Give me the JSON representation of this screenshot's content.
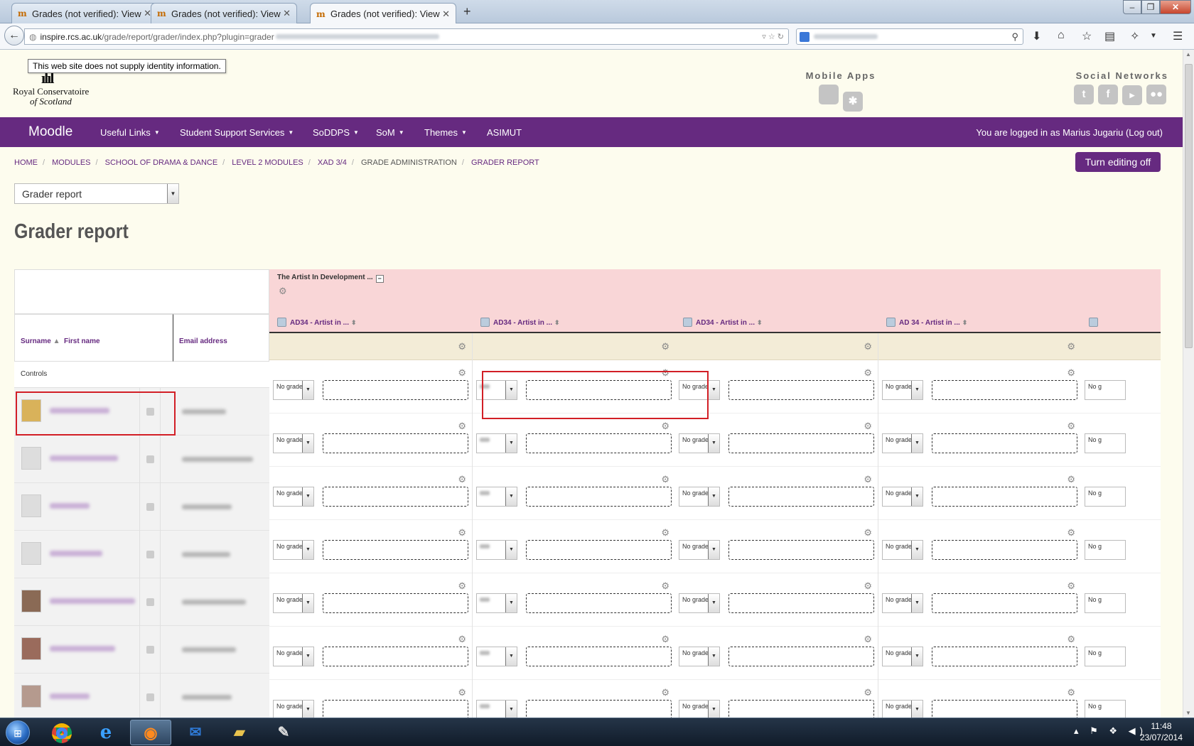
{
  "browser": {
    "tabs": [
      {
        "label": "Grades (not verified): View",
        "active": false
      },
      {
        "label": "Grades (not verified): View",
        "active": false
      },
      {
        "label": "Grades (not verified): View",
        "active": true
      }
    ],
    "url_host": "inspire.rcs.ac.uk",
    "url_path": "/grade/report/grader/index.php?plugin=grader",
    "identity_tooltip": "This web site does not supply identity information."
  },
  "logo": {
    "line1": "Royal Conservatoire",
    "line2": "of Scotland"
  },
  "header": {
    "mobile_apps_label": "Mobile Apps",
    "social_networks_label": "Social Networks"
  },
  "menu": {
    "brand": "Moodle",
    "items": [
      {
        "label": "Useful Links",
        "dropdown": true
      },
      {
        "label": "Student Support Services",
        "dropdown": true
      },
      {
        "label": "SoDDPS",
        "dropdown": true
      },
      {
        "label": "SoM",
        "dropdown": true
      },
      {
        "label": "Themes",
        "dropdown": true
      },
      {
        "label": "ASIMUT",
        "dropdown": false
      }
    ],
    "login_text": "You are logged in as Marius Jugariu (Log out)"
  },
  "breadcrumb": [
    "HOME",
    "MODULES",
    "SCHOOL OF DRAMA & DANCE",
    "LEVEL 2 MODULES",
    "XAD 3/4",
    "GRADE ADMINISTRATION",
    "GRADER REPORT"
  ],
  "edit_button_label": "Turn editing off",
  "report_selector_value": "Grader report",
  "page_title": "Grader report",
  "grader": {
    "surname_header": "Surname",
    "firstname_header": "First name",
    "email_header": "Email address",
    "controls_label": "Controls",
    "category_name": "The Artist In Development ...",
    "category_collapse_glyph": "−",
    "items": [
      "AD34 - Artist in ...",
      "AD34 - Artist in ...",
      "AD34 - Artist in ...",
      "AD 34 - Artist in ..."
    ],
    "no_grade_label": "No grade",
    "no_grade_clipped": "No g"
  },
  "taskbar": {
    "time": "11:48",
    "date": "23/07/2014"
  },
  "colors": {
    "brand_purple": "#662a80",
    "category_pink": "#f9d6d7",
    "highlight_red": "#d21f26"
  }
}
